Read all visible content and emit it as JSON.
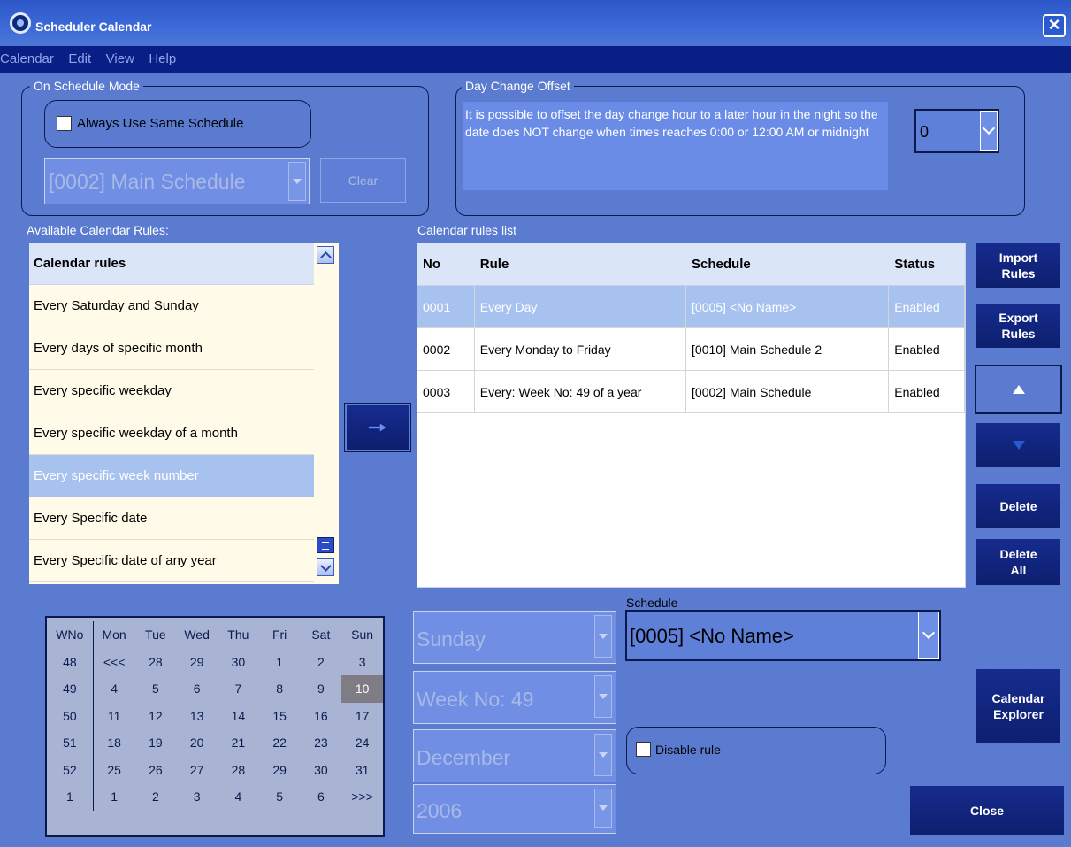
{
  "window": {
    "title": "Scheduler Calendar"
  },
  "menu": [
    "Calendar",
    "Edit",
    "View",
    "Help"
  ],
  "schedule_mode": {
    "title": "On Schedule Mode",
    "always_same_label": "Always Use Same Schedule",
    "schedule_value": "[0002] Main Schedule",
    "clear_label": "Clear"
  },
  "day_change": {
    "title": "Day Change Offset",
    "description": "It is possible to offset the day change hour to a later hour in the night so the date does NOT change when times reaches 0:00 or 12:00 AM or midnight",
    "offset_value": "0"
  },
  "available_rules": {
    "label": "Available Calendar Rules:",
    "header": "Calendar rules",
    "items": [
      "Every Saturday and Sunday",
      "Every days of specific month",
      "Every specific weekday",
      "Every specific weekday of a month",
      "Every specific week number",
      "Every Specific date",
      "Every Specific date of any year"
    ],
    "selected_index": 4
  },
  "rules_list": {
    "label": "Calendar rules list",
    "columns": [
      "No",
      "Rule",
      "Schedule",
      "Status"
    ],
    "rows": [
      [
        "0001",
        "Every Day",
        "[0005] <No Name>",
        "Enabled"
      ],
      [
        "0002",
        "Every Monday to Friday",
        "[0010] Main Schedule 2",
        "Enabled"
      ],
      [
        "0003",
        "Every: Week No: 49 of a year",
        "[0002] Main Schedule",
        "Enabled"
      ]
    ],
    "selected_index": 0
  },
  "side_buttons": {
    "import": "Import Rules",
    "export": "Export Rules",
    "delete": "Delete",
    "delete_all": "Delete All",
    "calendar_explorer": "Calendar Explorer",
    "close": "Close"
  },
  "calendar": {
    "headers": [
      "WNo",
      "Mon",
      "Tue",
      "Wed",
      "Thu",
      "Fri",
      "Sat",
      "Sun"
    ],
    "rows": [
      [
        "48",
        "<<<",
        "28",
        "29",
        "30",
        "1",
        "2",
        "3"
      ],
      [
        "49",
        "4",
        "5",
        "6",
        "7",
        "8",
        "9",
        "10"
      ],
      [
        "50",
        "11",
        "12",
        "13",
        "14",
        "15",
        "16",
        "17"
      ],
      [
        "51",
        "18",
        "19",
        "20",
        "21",
        "22",
        "23",
        "24"
      ],
      [
        "52",
        "25",
        "26",
        "27",
        "28",
        "29",
        "30",
        "31"
      ],
      [
        "1",
        "1",
        "2",
        "3",
        "4",
        "5",
        "6",
        ">>>"
      ]
    ],
    "today": "10"
  },
  "rule_params": {
    "weekday": "Sunday",
    "week": "Week No: 49",
    "month": "December",
    "year": "2006"
  },
  "schedule": {
    "label": "Schedule",
    "value": "[0005] <No Name>",
    "disable_label": "Disable rule"
  },
  "colors": {
    "background": "#5a7bd0",
    "menubar": "#0a1f86",
    "selection": "#a7c2ef",
    "button_dark": "#0d1f6e"
  }
}
